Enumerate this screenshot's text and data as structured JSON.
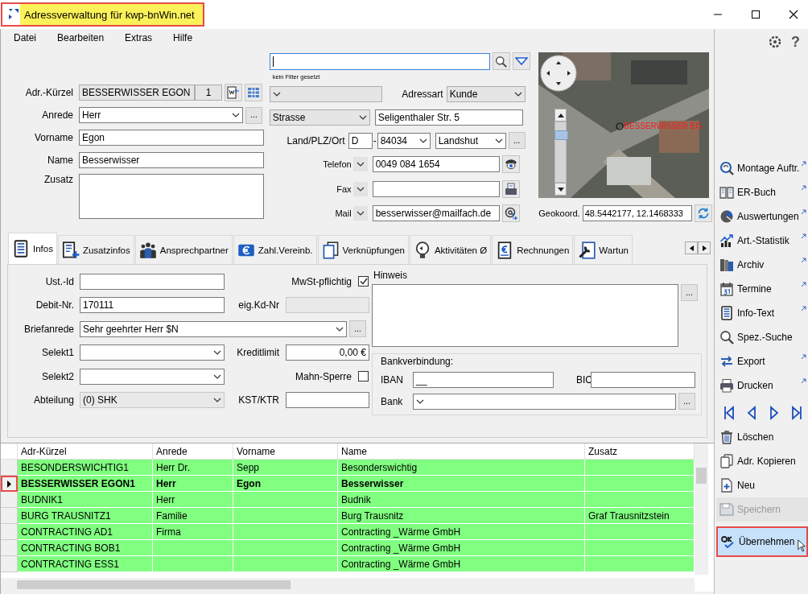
{
  "window": {
    "title": "Adressverwaltung für kwp-bnWin.net"
  },
  "menu": [
    {
      "label": "Datei"
    },
    {
      "label": "Bearbeiten"
    },
    {
      "label": "Extras"
    },
    {
      "label": "Hilfe"
    }
  ],
  "search": {
    "hint": "kein Filter gesetzt"
  },
  "address": [
    {
      "kind": "code",
      "label": "Adr.-Kürzel",
      "value": "BESSERWISSER EGON",
      "number": "1"
    },
    {
      "kind": "combo",
      "label": "Anrede",
      "value": "Herr",
      "more": "..."
    },
    {
      "kind": "text",
      "label": "Vorname",
      "value": "Egon"
    },
    {
      "kind": "text",
      "label": "Name",
      "value": "Besserwisser"
    },
    {
      "kind": "memo",
      "label": "Zusatz"
    }
  ],
  "address_type": {
    "label": "Adressart",
    "value": "Kunde"
  },
  "street": {
    "type": "Strasse",
    "value": "Seligenthaler Str. 5"
  },
  "location": {
    "label": "Land/PLZ/Ort",
    "country": "D",
    "separator": "-",
    "zip": "84034",
    "city": "Landshut",
    "more": "..."
  },
  "contacts": [
    {
      "kind": "phone",
      "label": "Telefon",
      "value": "0049 084 1654"
    },
    {
      "kind": "fax",
      "label": "Fax"
    },
    {
      "kind": "mail",
      "label": "Mail",
      "value": "besserwisser@mailfach.de"
    }
  ],
  "map": {
    "marker_label": "BESSERWISSER EG",
    "zoom": {
      "level": 0.85
    }
  },
  "geo": {
    "label": "Geokoord.",
    "value": "48.5442177, 12.1468333"
  },
  "tabs": [
    {
      "label": "Infos",
      "kind": "tablet",
      "selected": true
    },
    {
      "label": "Zusatzinfos",
      "kind": "document-plus",
      "selected": false
    },
    {
      "label": "Ansprechpartner",
      "kind": "people",
      "selected": false
    },
    {
      "label": "Zahl.Vereinb.",
      "kind": "euro-card",
      "selected": false
    },
    {
      "label": "Verknüpfungen",
      "kind": "documents",
      "selected": false
    },
    {
      "label": "Aktivitäten Ø",
      "kind": "lightbulb",
      "selected": false
    },
    {
      "label": "Rechnungen",
      "kind": "euro-document",
      "selected": false
    },
    {
      "label": "Wartun",
      "kind": "wrench-document",
      "selected": false
    }
  ],
  "info": {
    "rows": [
      {
        "label": "Ust.-Id",
        "kind": "text",
        "disabled": false,
        "right": {
          "label": "MwSt-pflichtig",
          "kind": "checkbox",
          "checked": true
        }
      },
      {
        "label": "Debit-Nr.",
        "kind": "text",
        "value": "170111",
        "disabled": false,
        "right": {
          "label": "eig.Kd-Nr",
          "kind": "text",
          "disabled": true
        }
      },
      {
        "label": "Briefanrede",
        "kind": "wide_combo",
        "value": "Sehr geehrter Herr $N",
        "more": "...",
        "disabled": false
      },
      {
        "label": "Selekt1",
        "kind": "combo",
        "disabled": false,
        "right": {
          "label": "Kreditlimit",
          "kind": "amount",
          "value": "0,00 €",
          "disabled": false
        }
      },
      {
        "label": "Selekt2",
        "kind": "combo",
        "disabled": false,
        "right": {
          "label": "Mahn-Sperre",
          "kind": "checkbox",
          "checked": false
        }
      },
      {
        "label": "Abteilung",
        "kind": "combo",
        "value": "(0) SHK",
        "disabled": true,
        "right": {
          "label": "KST/KTR",
          "kind": "text",
          "disabled": false
        }
      }
    ],
    "note": {
      "label": "Hinweis",
      "more": "..."
    },
    "bank": {
      "title": "Bankverbindung:",
      "iban_label": "IBAN",
      "iban": "__",
      "bic_label": "BIC",
      "bank_label": "Bank",
      "more": "..."
    }
  },
  "table": {
    "columns": [
      "Adr-Kürzel",
      "Anrede",
      "Vorname",
      "Name",
      "Zusatz"
    ],
    "rows": [
      {
        "cells": [
          "BESONDERSWICHTIG1",
          "Herr Dr.",
          "Sepp",
          "Besonderswichtig",
          ""
        ],
        "selected": false
      },
      {
        "cells": [
          "BESSERWISSER EGON1",
          "Herr",
          "Egon",
          "Besserwisser",
          ""
        ],
        "selected": true
      },
      {
        "cells": [
          "BUDNIK1",
          "Herr",
          "",
          "Budnik",
          ""
        ],
        "selected": false
      },
      {
        "cells": [
          "BURG TRAUSNITZ1",
          "Familie",
          "",
          "Burg Trausnitz",
          "Graf Trausnitzstein"
        ],
        "selected": false
      },
      {
        "cells": [
          "CONTRACTING AD1",
          "Firma",
          "",
          "Contracting _Wärme GmbH",
          ""
        ],
        "selected": false
      },
      {
        "cells": [
          "CONTRACTING BOB1",
          "",
          "",
          "Contracting _Wärme GmbH",
          ""
        ],
        "selected": false
      },
      {
        "cells": [
          "CONTRACTING ESS1",
          "",
          "",
          "Contracting _Wärme GmbH",
          ""
        ],
        "selected": false
      }
    ]
  },
  "sidebar": {
    "help": "?",
    "actions": [
      {
        "label": "Montage Auftr.",
        "kind": "magnifier",
        "external": true
      },
      {
        "label": "ER-Buch",
        "kind": "book",
        "external": true
      },
      {
        "label": "Auswertungen",
        "kind": "pie-chart",
        "external": true
      },
      {
        "label": "Art.-Statistik",
        "kind": "bar-chart",
        "external": true
      },
      {
        "label": "Archiv",
        "kind": "binders",
        "external": true
      },
      {
        "label": "Termine",
        "kind": "calendar",
        "external": true
      },
      {
        "label": "Info-Text",
        "kind": "tablet",
        "external": true
      },
      {
        "label": "Spez.-Suche",
        "kind": "search",
        "external": false
      },
      {
        "label": "Export",
        "kind": "arrows",
        "external": true
      },
      {
        "label": "Drucken",
        "kind": "printer",
        "external": true
      }
    ],
    "navigation": [
      {
        "kind": "first"
      },
      {
        "kind": "previous"
      },
      {
        "kind": "next"
      },
      {
        "kind": "last"
      }
    ],
    "actions_bottom": [
      {
        "label": "Löschen",
        "kind": "trash",
        "disabled": false,
        "hovered": false
      },
      {
        "label": "Adr. Kopieren",
        "kind": "copy",
        "disabled": false,
        "hovered": false
      },
      {
        "label": "Neu",
        "kind": "new-document",
        "disabled": false,
        "hovered": false
      },
      {
        "label": "Speichern",
        "kind": "floppy-disk",
        "disabled": true,
        "hovered": false
      },
      {
        "label": "Übernehmen",
        "kind": "ok-check",
        "disabled": false,
        "hovered": true
      }
    ]
  }
}
